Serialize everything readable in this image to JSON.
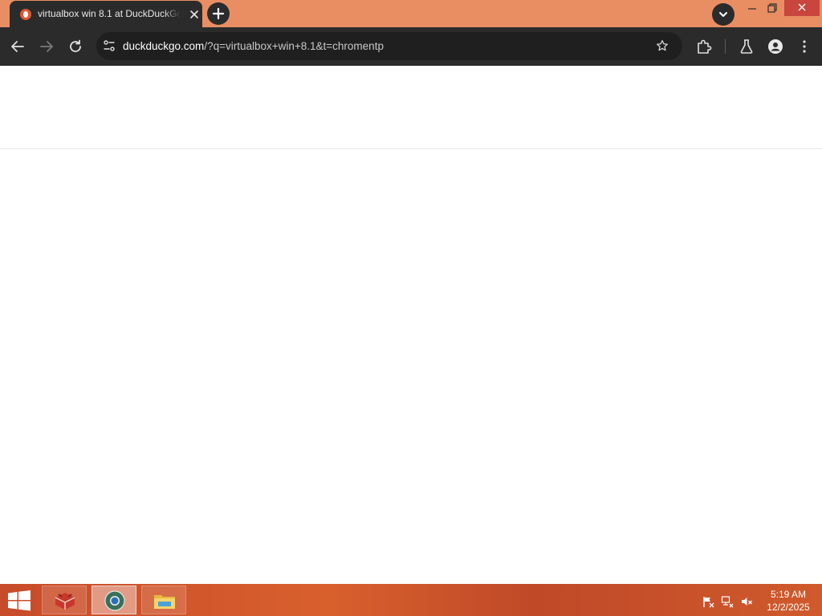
{
  "browser": {
    "tab": {
      "title": "virtualbox win 8.1 at DuckDuckGo",
      "favicon": "duckduckgo-icon"
    },
    "address_bar": {
      "host": "duckduckgo.com",
      "path": "/?q=virtualbox+win+8.1&t=chromentp"
    },
    "colors": {
      "frame": "#e98e63",
      "toolbar": "#2b2b2b",
      "close_button": "#c8463d"
    }
  },
  "taskbar": {
    "apps": [
      {
        "name": "virtualbox-icon",
        "active": false
      },
      {
        "name": "chrome-icon",
        "active": true
      },
      {
        "name": "file-explorer-icon",
        "active": false
      }
    ],
    "tray_icons": [
      "action-center-flag-icon",
      "network-icon",
      "volume-muted-icon"
    ],
    "clock": {
      "time": "5:19 AM",
      "date": "12/2/2025"
    }
  }
}
